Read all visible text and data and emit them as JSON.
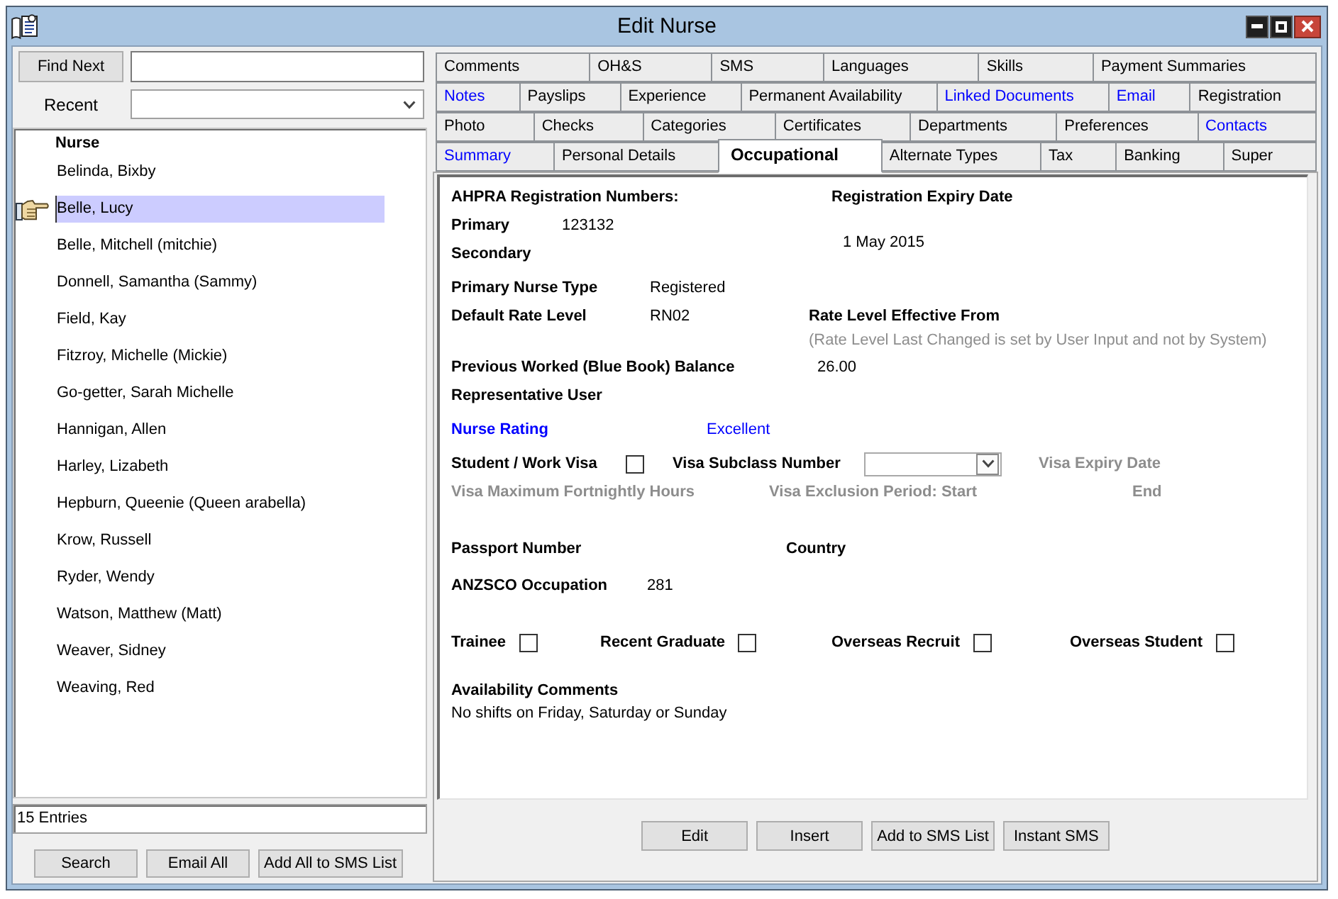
{
  "window": {
    "title": "Edit Nurse"
  },
  "search": {
    "find_button": "Find Next",
    "recent_label": "Recent"
  },
  "nurse_list": {
    "column": "Nurse",
    "items": [
      {
        "name": "Belinda, Bixby",
        "selected": false
      },
      {
        "name": "Belle, Lucy",
        "selected": true
      },
      {
        "name": "Belle, Mitchell (mitchie)",
        "selected": false
      },
      {
        "name": "Donnell, Samantha (Sammy)",
        "selected": false
      },
      {
        "name": "Field, Kay",
        "selected": false
      },
      {
        "name": "Fitzroy, Michelle (Mickie)",
        "selected": false
      },
      {
        "name": "Go-getter, Sarah Michelle",
        "selected": false
      },
      {
        "name": "Hannigan, Allen",
        "selected": false
      },
      {
        "name": "Harley, Lizabeth",
        "selected": false
      },
      {
        "name": "Hepburn, Queenie (Queen arabella)",
        "selected": false
      },
      {
        "name": "Krow, Russell",
        "selected": false
      },
      {
        "name": "Ryder, Wendy",
        "selected": false
      },
      {
        "name": "Watson, Matthew (Matt)",
        "selected": false
      },
      {
        "name": "Weaver, Sidney",
        "selected": false
      },
      {
        "name": "Weaving, Red",
        "selected": false
      }
    ]
  },
  "entries": "15 Entries",
  "list_buttons": [
    "Search",
    "Email All",
    "Add All to SMS List"
  ],
  "tab_rows": [
    [
      {
        "label": "Comments",
        "selected": false,
        "color": "#000000"
      },
      {
        "label": "OH&S",
        "selected": false,
        "color": "#000000"
      },
      {
        "label": "SMS",
        "selected": false,
        "color": "#000000"
      },
      {
        "label": "Languages",
        "selected": false,
        "color": "#000000"
      },
      {
        "label": "Skills",
        "selected": false,
        "color": "#000000"
      },
      {
        "label": "Payment Summaries",
        "selected": false,
        "color": "#000000"
      }
    ],
    [
      {
        "label": "Notes",
        "selected": false,
        "color": "#0000ff"
      },
      {
        "label": "Payslips",
        "selected": false,
        "color": "#000000"
      },
      {
        "label": "Experience",
        "selected": false,
        "color": "#000000"
      },
      {
        "label": "Permanent Availability",
        "selected": false,
        "color": "#000000"
      },
      {
        "label": "Linked Documents",
        "selected": false,
        "color": "#0000ff"
      },
      {
        "label": "Email",
        "selected": false,
        "color": "#0000ff"
      },
      {
        "label": "Registration",
        "selected": false,
        "color": "#000000"
      }
    ],
    [
      {
        "label": "Photo",
        "selected": false,
        "color": "#000000"
      },
      {
        "label": "Checks",
        "selected": false,
        "color": "#000000"
      },
      {
        "label": "Categories",
        "selected": false,
        "color": "#000000"
      },
      {
        "label": "Certificates",
        "selected": false,
        "color": "#000000"
      },
      {
        "label": "Departments",
        "selected": false,
        "color": "#000000"
      },
      {
        "label": "Preferences",
        "selected": false,
        "color": "#000000"
      },
      {
        "label": "Contacts",
        "selected": false,
        "color": "#0000ff"
      }
    ],
    [
      {
        "label": "Summary",
        "selected": false,
        "color": "#0000ff"
      },
      {
        "label": "Personal Details",
        "selected": false,
        "color": "#000000"
      },
      {
        "label": "Occupational",
        "selected": true,
        "color": "#000000"
      },
      {
        "label": "Alternate Types",
        "selected": false,
        "color": "#000000"
      },
      {
        "label": "Tax",
        "selected": false,
        "color": "#000000"
      },
      {
        "label": "Banking",
        "selected": false,
        "color": "#000000"
      },
      {
        "label": "Super",
        "selected": false,
        "color": "#000000"
      }
    ]
  ],
  "occupational": {
    "registration_heading": "AHPRA Registration Numbers:",
    "expiry_heading": "Registration Expiry Date",
    "primary": {
      "label": "Primary",
      "value": "123132"
    },
    "secondary": {
      "label": "Secondary"
    },
    "expiry_date": "1 May 2015",
    "nurse_type": {
      "label": "Primary Nurse Type",
      "value": "Registered"
    },
    "rate_level": {
      "label": "Default Rate Level",
      "value": "RN02"
    },
    "rate_effective": {
      "label": "Rate Level Effective From",
      "note": "(Rate Level Last Changed is set by User Input and not by System)"
    },
    "blue_book_balance": {
      "label": "Previous Worked (Blue Book) Balance",
      "value": "26.00"
    },
    "representative_user": {
      "label": "Representative User"
    },
    "nurse_rating": {
      "label": "Nurse Rating",
      "value": "Excellent"
    },
    "student_visa": {
      "label": "Student / Work Visa",
      "checked": false
    },
    "visa_subclass": {
      "label": "Visa Subclass Number"
    },
    "visa_expiry": {
      "label": "Visa Expiry Date",
      "disabled": true
    },
    "visa_max_hours": {
      "label": "Visa Maximum Fortnightly Hours",
      "disabled": true
    },
    "visa_exclusion_start": {
      "label": "Visa Exclusion Period: Start",
      "disabled": true
    },
    "visa_exclusion_end": {
      "label": "End",
      "disabled": true
    },
    "passport_number": {
      "label": "Passport Number"
    },
    "country": {
      "label": "Country"
    },
    "anzsco": {
      "label": "ANZSCO Occupation",
      "value": "281"
    },
    "flags": [
      {
        "label": "Trainee",
        "checked": false
      },
      {
        "label": "Recent Graduate",
        "checked": false
      },
      {
        "label": "Overseas Recruit",
        "checked": false
      },
      {
        "label": "Overseas Student",
        "checked": false
      }
    ],
    "availability": {
      "label": "Availability Comments",
      "value": "No shifts on Friday, Saturday or Sunday"
    }
  },
  "form_buttons": [
    "Edit",
    "Insert",
    "Add to SMS List",
    "Instant SMS"
  ]
}
